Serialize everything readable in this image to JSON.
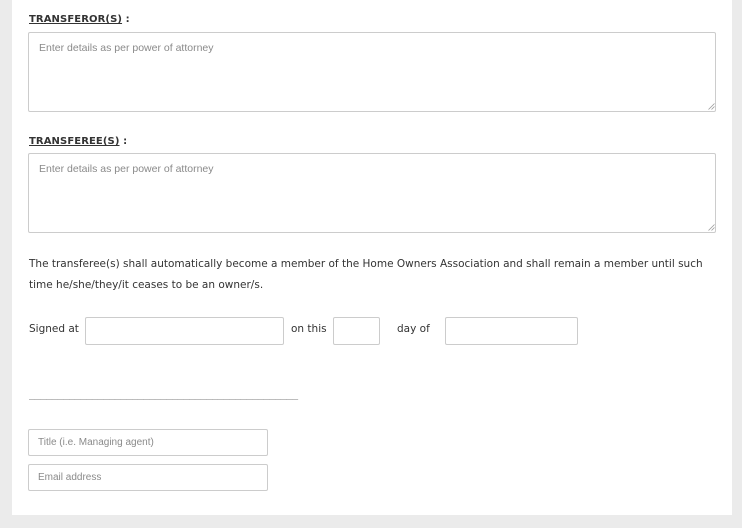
{
  "transferors": {
    "label": "TRANSFEROR(S)",
    "label_suffix": " :",
    "placeholder": "Enter details as per power of attorney",
    "value": ""
  },
  "transferees": {
    "label": "TRANSFEREE(S)",
    "label_suffix": " :",
    "placeholder": "Enter details as per power of attorney",
    "value": ""
  },
  "membership_clause": "The transferee(s) shall automatically become a member of the Home Owners Association and shall remain a member until such time he/she/they/it ceases to be an owner/s.",
  "signing": {
    "signed_at_label": "Signed at",
    "on_this_label": "on this",
    "day_of_label": "day of",
    "place_value": "",
    "day_value": "",
    "month_value": ""
  },
  "signature_line": "_______________________________________________",
  "title_field": {
    "placeholder": "Title (i.e. Managing agent)",
    "value": ""
  },
  "email_field": {
    "placeholder": "Email address",
    "value": ""
  }
}
